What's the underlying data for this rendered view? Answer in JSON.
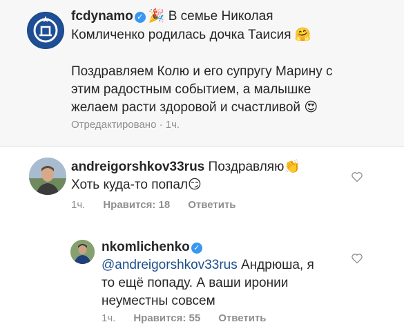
{
  "post": {
    "username": "fcdynamo",
    "emoji_party": "🎉",
    "line1": "В семье Николая",
    "line2": "Комличенко родилась дочка Таисия",
    "emoji_hug": "🤗",
    "line3": "Поздравляем Колю и его супругу Марину с",
    "line4": "этим радостным событием, а малышке",
    "line5": "желаем расти здоровой и счастливой",
    "emoji_heart_eyes": "😍",
    "meta": "Отредактировано · 1ч."
  },
  "comment1": {
    "username": "andreigorshkov33rus",
    "text1": "Поздравляю",
    "emoji_clap": "👏",
    "text2": "Хоть куда-то попал",
    "emoji_smirk": "😏",
    "time": "1ч.",
    "likes": "Нравится: 18",
    "reply": "Ответить"
  },
  "reply1": {
    "username": "nkomlichenko",
    "mention": "@andreigorshkov33rus",
    "text1": "Андрюша, я",
    "text2": "то ещё попаду. А ваши иронии",
    "text3": "неуместны совсем",
    "time": "1ч.",
    "likes": "Нравится: 55",
    "reply": "Ответить"
  },
  "icons": {
    "verified": "✓",
    "heart": "heart-outline-icon",
    "accent": "#3897f0"
  }
}
